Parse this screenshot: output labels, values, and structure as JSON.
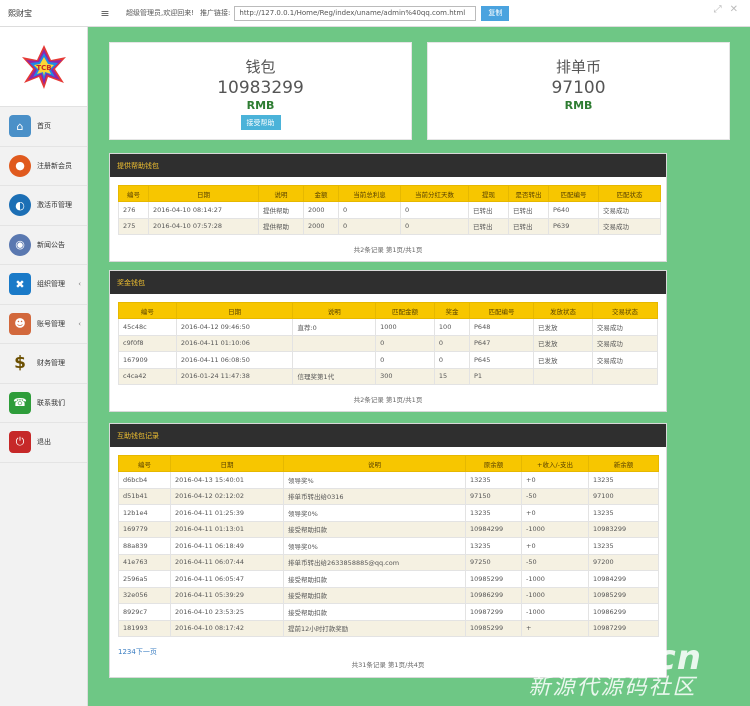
{
  "topbar": {
    "logo": "熙财宝",
    "menu_icon": "hamburger-icon",
    "welcome": "超级管理员,欢迎回来!",
    "promo_label": "推广链接:",
    "promo_url": "http://127.0.0.1/Home/Reg/index/uname/admin%40qq.com.html",
    "copy_label": "复制"
  },
  "sidebar": {
    "brand_text": "TCB",
    "items": [
      {
        "label": "首页",
        "icon": "home-icon"
      },
      {
        "label": "注册新会员",
        "icon": "user-add-icon"
      },
      {
        "label": "激活币管理",
        "icon": "globe-icon"
      },
      {
        "label": "新闻公告",
        "icon": "news-icon"
      },
      {
        "label": "组织管理",
        "icon": "organization-icon"
      },
      {
        "label": "账号管理",
        "icon": "users-icon"
      },
      {
        "label": "财务管理",
        "icon": "dollar-icon"
      },
      {
        "label": "联系我们",
        "icon": "contact-icon"
      },
      {
        "label": "退出",
        "icon": "power-icon"
      }
    ]
  },
  "wallet": {
    "title": "钱包",
    "value": "10983299",
    "unit": "RMB",
    "button": "接受帮助"
  },
  "coin": {
    "title": "排单币",
    "value": "97100",
    "unit": "RMB"
  },
  "provide": {
    "title": "提供帮助钱包",
    "headers": [
      "编号",
      "日期",
      "说明",
      "金额",
      "当前总利息",
      "当前分红天数",
      "提现",
      "是否转出",
      "匹配编号",
      "匹配状态"
    ],
    "rows": [
      [
        "276",
        "2016-04-10 08:14:27",
        "提供帮助",
        "2000",
        "0",
        "0",
        "已转出",
        "已转出",
        "P640",
        "交易成功"
      ],
      [
        "275",
        "2016-04-10 07:57:28",
        "提供帮助",
        "2000",
        "0",
        "0",
        "已转出",
        "已转出",
        "P639",
        "交易成功"
      ]
    ],
    "pager": "共2条记录 第1页/共1页"
  },
  "bonus": {
    "title": "奖金钱包",
    "headers": [
      "编号",
      "日期",
      "说明",
      "匹配金额",
      "奖金",
      "匹配编号",
      "发放状态",
      "交易状态"
    ],
    "rows": [
      [
        "45c48c",
        "2016-04-12 09:46:50",
        "直荐:0",
        "1000",
        "100",
        "P648",
        "已发放",
        "交易成功"
      ],
      [
        "c9f0f8",
        "2016-04-11 01:10:06",
        "",
        "0",
        "0",
        "P647",
        "已发放",
        "交易成功"
      ],
      [
        "167909",
        "2016-04-11 06:08:50",
        "",
        "0",
        "0",
        "P645",
        "已发放",
        "交易成功"
      ],
      [
        "c4ca42",
        "2016-01-24 11:47:38",
        "信理奖第1代",
        "300",
        "15",
        "P1",
        "",
        ""
      ]
    ],
    "pager": "共2条记录 第1页/共1页"
  },
  "mutual": {
    "title": "互助钱包记录",
    "headers": [
      "编号",
      "日期",
      "说明",
      "原余额",
      "+收入/-支出",
      "新余额"
    ],
    "rows": [
      [
        "d6bcb4",
        "2016-04-13 15:40:01",
        "领导奖%",
        "13235",
        "+0",
        "13235"
      ],
      [
        "d51b41",
        "2016-04-12 02:12:02",
        "排单币转出给0316",
        "97150",
        "-50",
        "97100"
      ],
      [
        "12b1e4",
        "2016-04-11 01:25:39",
        "领导奖0%",
        "13235",
        "+0",
        "13235"
      ],
      [
        "169779",
        "2016-04-11 01:13:01",
        "接受帮助扣款",
        "10984299",
        "-1000",
        "10983299"
      ],
      [
        "88a839",
        "2016-04-11 06:18:49",
        "领导奖0%",
        "13235",
        "+0",
        "13235"
      ],
      [
        "41e763",
        "2016-04-11 06:07:44",
        "排单币转出给2633858885@qq.com",
        "97250",
        "-50",
        "97200"
      ],
      [
        "2596a5",
        "2016-04-11 06:05:47",
        "接受帮助扣款",
        "10985299",
        "-1000",
        "10984299"
      ],
      [
        "32e056",
        "2016-04-11 05:39:29",
        "接受帮助扣款",
        "10986299",
        "-1000",
        "10985299"
      ],
      [
        "8929c7",
        "2016-04-10 23:53:25",
        "接受帮助扣款",
        "10987299",
        "-1000",
        "10986299"
      ],
      [
        "181993",
        "2016-04-10 08:17:42",
        "提前12小时打款奖励",
        "10985299",
        "+",
        "10987299"
      ]
    ],
    "pager_links": "1234下一页",
    "pager": "共31条记录 第1页/共4页"
  },
  "watermark": {
    "main": "XYDai.cn",
    "sub": "新源代源码社区"
  }
}
